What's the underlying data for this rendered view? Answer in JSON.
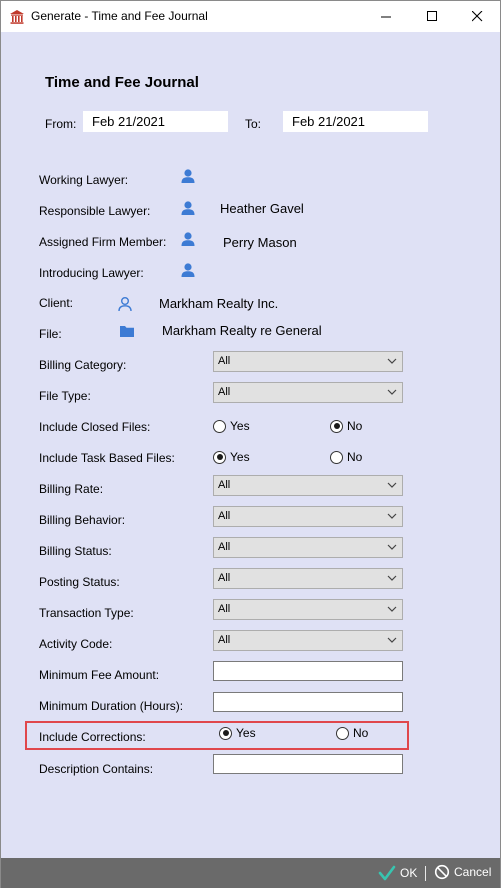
{
  "window": {
    "title": "Generate - Time and Fee Journal",
    "icon": "building-columns-icon"
  },
  "heading": "Time and Fee Journal",
  "date_range": {
    "from_label": "From:",
    "from_value": "Feb 21/2021",
    "to_label": "To:",
    "to_value": "Feb 21/2021"
  },
  "people": {
    "working_lawyer": {
      "label": "Working Lawyer:",
      "value": ""
    },
    "responsible_lawyer": {
      "label": "Responsible Lawyer:",
      "value": "Heather Gavel"
    },
    "assigned_firm_member": {
      "label": "Assigned Firm Member:",
      "value": "Perry Mason"
    },
    "introducing_lawyer": {
      "label": "Introducing Lawyer:",
      "value": ""
    },
    "client": {
      "label": "Client:",
      "value": "Markham Realty Inc."
    },
    "file": {
      "label": "File:",
      "value": "Markham Realty re General"
    }
  },
  "filters": {
    "billing_category": {
      "label": "Billing Category:",
      "value": "All"
    },
    "file_type": {
      "label": "File Type:",
      "value": "All"
    },
    "billing_rate": {
      "label": "Billing Rate:",
      "value": "All"
    },
    "billing_behavior": {
      "label": "Billing Behavior:",
      "value": "All"
    },
    "billing_status": {
      "label": "Billing Status:",
      "value": "All"
    },
    "posting_status": {
      "label": "Posting Status:",
      "value": "All"
    },
    "transaction_type": {
      "label": "Transaction Type:",
      "value": "All"
    },
    "activity_code": {
      "label": "Activity Code:",
      "value": "All"
    }
  },
  "radios": {
    "include_closed_files": {
      "label": "Include Closed Files:",
      "yes": "Yes",
      "no": "No",
      "selected": "no"
    },
    "include_task_based_files": {
      "label": "Include Task Based Files:",
      "yes": "Yes",
      "no": "No",
      "selected": "yes"
    },
    "include_corrections": {
      "label": "Include Corrections:",
      "yes": "Yes",
      "no": "No",
      "selected": "yes"
    }
  },
  "inputs": {
    "minimum_fee_amount": {
      "label": "Minimum Fee Amount:",
      "value": ""
    },
    "minimum_duration": {
      "label": "Minimum Duration (Hours):",
      "value": ""
    },
    "description_contains": {
      "label": "Description Contains:",
      "value": ""
    }
  },
  "footer": {
    "ok_label": "OK",
    "cancel_label": "Cancel"
  },
  "colors": {
    "background": "#dfe1f5",
    "accent_blue": "#3d7bd4",
    "highlight_red": "#e0474c",
    "footer_bg": "#6a6a6a",
    "ok_check": "#37c5b0"
  }
}
